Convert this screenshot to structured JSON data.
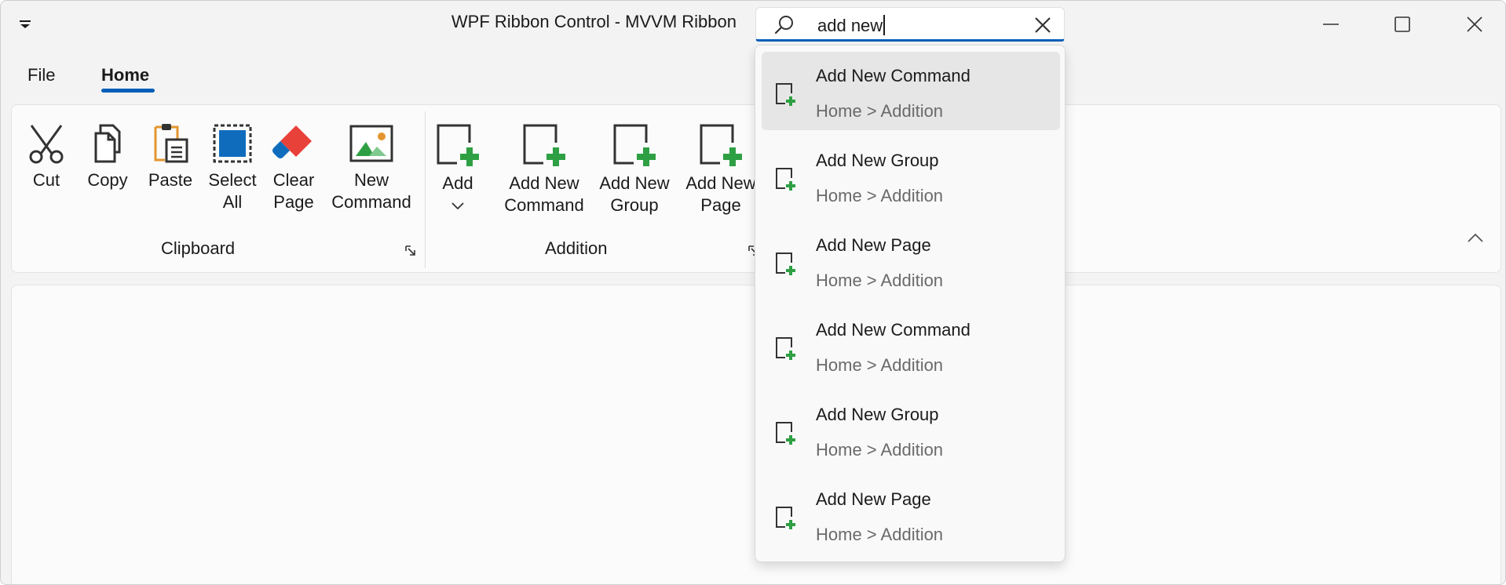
{
  "window": {
    "title": "WPF Ribbon Control - MVVM Ribbon"
  },
  "search": {
    "value": "add new"
  },
  "tabs": [
    {
      "label": "File"
    },
    {
      "label": "Home"
    }
  ],
  "ribbon": {
    "clipboard": {
      "label": "Clipboard",
      "buttons": [
        {
          "label": "Cut",
          "icon": "scissors-icon"
        },
        {
          "label": "Copy",
          "icon": "copy-icon"
        },
        {
          "label": "Paste",
          "icon": "paste-icon"
        },
        {
          "line1": "Select",
          "line2": "All",
          "icon": "select-all-icon"
        },
        {
          "line1": "Clear",
          "line2": "Page",
          "icon": "eraser-icon"
        },
        {
          "line1": "New",
          "line2": "Command",
          "icon": "image-icon"
        }
      ]
    },
    "addition": {
      "label": "Addition",
      "buttons": [
        {
          "line1": "Add",
          "icon": "add-document-icon"
        },
        {
          "line1": "Add New",
          "line2": "Command",
          "icon": "add-document-icon"
        },
        {
          "line1": "Add New",
          "line2": "Group",
          "icon": "add-document-icon"
        },
        {
          "line1": "Add New",
          "line2": "Page",
          "icon": "add-document-icon"
        }
      ]
    }
  },
  "results": [
    {
      "title": "Add New Command",
      "path": "Home > Addition"
    },
    {
      "title": "Add New Group",
      "path": "Home > Addition"
    },
    {
      "title": "Add New Page",
      "path": "Home > Addition"
    },
    {
      "title": "Add New Command",
      "path": "Home > Addition"
    },
    {
      "title": "Add New Group",
      "path": "Home > Addition"
    },
    {
      "title": "Add New Page",
      "path": "Home > Addition"
    }
  ],
  "colors": {
    "accent": "#005fb8",
    "green": "#2ea043",
    "red": "#e8413a",
    "orange": "#e3962f",
    "blue": "#0f6cbd"
  }
}
